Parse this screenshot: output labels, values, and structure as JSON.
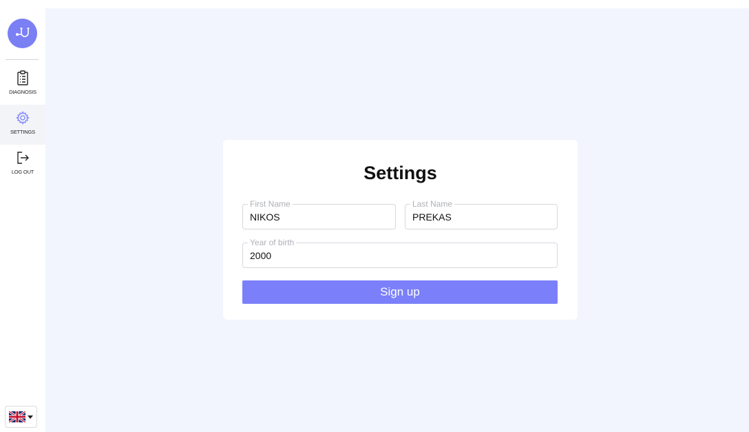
{
  "sidebar": {
    "logo_icon": "stethoscope-icon",
    "items": [
      {
        "label": "DIAGNOSIS",
        "icon": "clipboard-icon",
        "active": false
      },
      {
        "label": "SETTINGS",
        "icon": "gear-icon",
        "active": true
      },
      {
        "label": "LOG OUT",
        "icon": "logout-icon",
        "active": false
      }
    ],
    "language": {
      "flag": "uk-flag-icon",
      "dropdown_icon": "caret-down-icon"
    }
  },
  "form": {
    "title": "Settings",
    "first_name": {
      "label": "First Name",
      "value": "NIKOS"
    },
    "last_name": {
      "label": "Last Name",
      "value": "PREKAS"
    },
    "year_of_birth": {
      "label": "Year of birth",
      "value": "2000"
    },
    "submit_label": "Sign up"
  },
  "colors": {
    "accent": "#7b80fa",
    "background": "#f2f5fe",
    "card": "#ffffff"
  }
}
